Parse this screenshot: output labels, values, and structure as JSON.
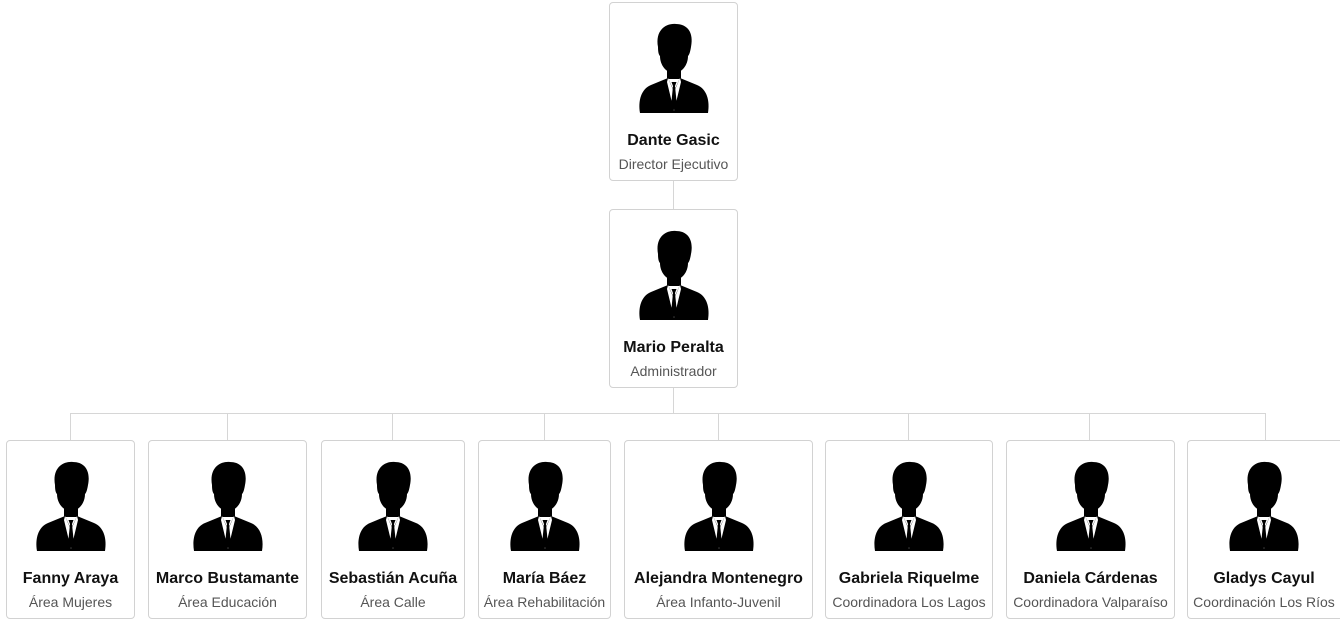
{
  "chart": {
    "root": {
      "name": "Dante Gasic",
      "role": "Director Ejecutivo",
      "children": [
        {
          "name": "Mario Peralta",
          "role": "Administrador",
          "children": [
            {
              "name": "Fanny Araya",
              "role": "Área Mujeres"
            },
            {
              "name": "Marco Bustamante",
              "role": "Área Educación"
            },
            {
              "name": "Sebastián Acuña",
              "role": "Área Calle"
            },
            {
              "name": "María Báez",
              "role": "Área Rehabilitación"
            },
            {
              "name": "Alejandra Montenegro",
              "role": "Área Infanto-Juvenil"
            },
            {
              "name": "Gabriela Riquelme",
              "role": "Coordinadora Los Lagos"
            },
            {
              "name": "Daniela Cárdenas",
              "role": "Coordinadora Valparaíso"
            },
            {
              "name": "Gladys Cayul",
              "role": "Coordinación Los Ríos"
            }
          ]
        }
      ]
    },
    "avatar_icon": "person-in-suit-icon",
    "colors": {
      "border": "#d2d2d2",
      "connector": "#d6d6d6",
      "name": "#111111",
      "role": "#555555"
    }
  }
}
